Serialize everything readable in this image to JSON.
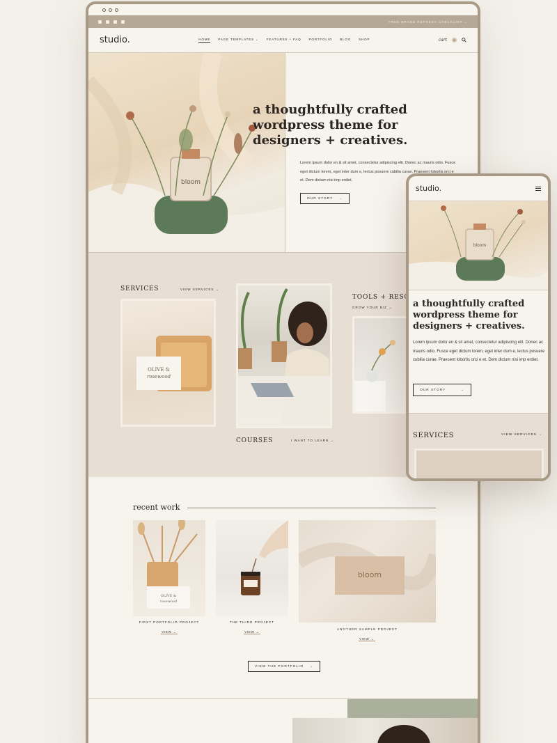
{
  "desktop": {
    "topbar": {
      "promo": "FREE BRAND REFRESH CHECKLIST →"
    },
    "nav": {
      "logo": "studio.",
      "items": [
        "HOME",
        "PAGE TEMPLATES ⌄",
        "FEATURES + FAQ",
        "PORTFOLIO",
        "BLOG",
        "SHOP"
      ],
      "cart_label": "cart",
      "cart_count": "0"
    },
    "hero": {
      "title": "a thoughtfully crafted wordpress theme for designers + creatives.",
      "body": "Lorem ipsum dolor en & sit amet, consectetur adipiscing elit. Donec ac mauris odio. Fusce eget dictum lorem, eget inter dum e, lectus posuere cubilia curae. Praesent lobortis orci e et. Dem dictum nisi imp erdiet.",
      "button": "OUR STORY",
      "arrow": "→",
      "product_label": "bloom"
    },
    "services": {
      "title": "SERVICES",
      "link": "VIEW SERVICES →",
      "card_label_1": "OLIVE &",
      "card_label_2": "rosewood",
      "courses_title": "COURSES",
      "courses_link": "I WANT TO LEARN →",
      "tools_title": "TOOLS + RESOU",
      "tools_link": "GROW YOUR BIZ →"
    },
    "recent": {
      "title": "recent work",
      "projects": [
        {
          "caption": "FIRST PORTFOLIO PROJECT",
          "view": "VIEW →",
          "label_1": "OLIVE &",
          "label_2": "rosewood"
        },
        {
          "caption": "THE THIRD PROJECT",
          "view": "VIEW →"
        },
        {
          "caption": "ANOTHER SAMPLE PROJECT",
          "view": "VIEW →",
          "label": "bloom"
        }
      ],
      "portfolio_button": "VIEW THE PORTFOLIO"
    }
  },
  "phone": {
    "logo": "studio.",
    "hero_title": "a thoughtfully crafted wordpress theme for designers + creatives.",
    "body": "Lorem ipsum dolor en & sit amet, consectetur adipiscing elit. Donec ac mauris odio. Fusce eget dictum lorem, eget inter dum e, lectus posuere cubilia curae. Praesent lobortis orci e et. Dem dictum nisi imp erdiet.",
    "button": "OUR STORY",
    "services_title": "SERVICES",
    "services_link": "VIEW SERVICES →",
    "product_label": "bloom"
  },
  "colors": {
    "frame": "#a89a86",
    "topbar": "#b5a996",
    "services_bg": "#e7ded4",
    "sage": "#aab09c",
    "cream": "#f7f4ee"
  }
}
